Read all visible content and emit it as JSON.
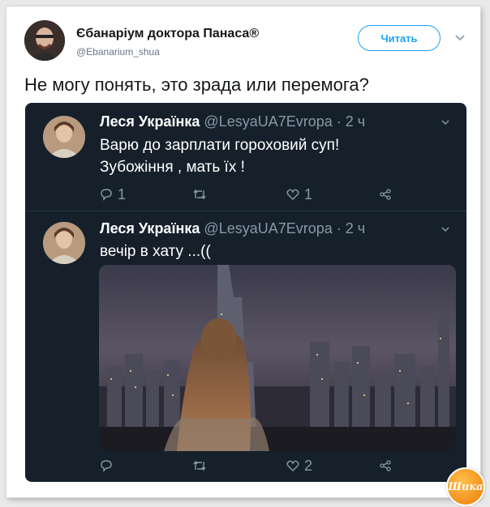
{
  "header": {
    "author_name": "Єбанаріум доктора Панаса®",
    "author_handle": "@Ebanarium_shua",
    "follow_label": "Читать"
  },
  "tweet": {
    "text": "Не могу понять, это зрада или перемога?"
  },
  "replies": [
    {
      "name": "Леся Українка",
      "meta": "@LesyaUA7Evropa · 2 ч",
      "lines": [
        "Варю до зарплати гороховий суп!",
        "Зубожіння , мать їх !"
      ],
      "reply_count": "1",
      "retweet_count": "",
      "like_count": "1"
    },
    {
      "name": "Леся Українка",
      "meta": "@LesyaUA7Evropa · 2 ч",
      "lines": [
        "вечір в хату ...(("
      ],
      "reply_count": "",
      "retweet_count": "",
      "like_count": "2"
    }
  ],
  "watermark": {
    "text": "Шика"
  },
  "colors": {
    "accent": "#1da1f2",
    "dark_bg": "#15202b",
    "muted": "#8899a6"
  }
}
